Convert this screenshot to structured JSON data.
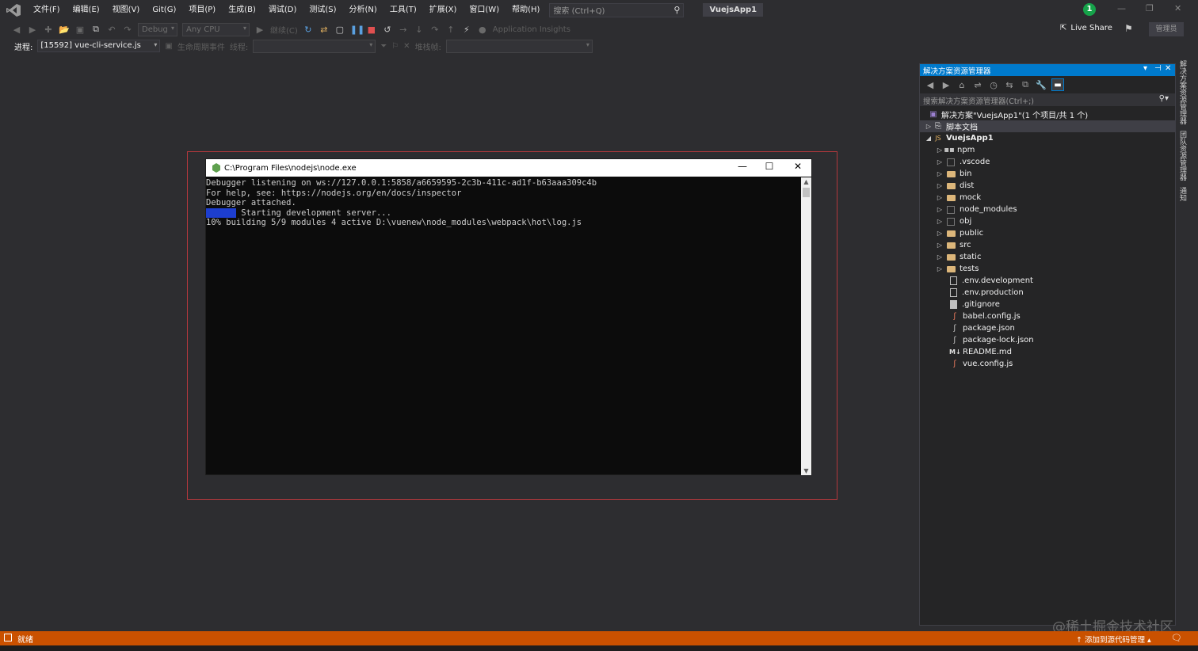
{
  "menubar": {
    "items": [
      "文件(F)",
      "编辑(E)",
      "视图(V)",
      "Git(G)",
      "项目(P)",
      "生成(B)",
      "调试(D)",
      "测试(S)",
      "分析(N)",
      "工具(T)",
      "扩展(X)",
      "窗口(W)",
      "帮助(H)"
    ],
    "search_placeholder": "搜索 (Ctrl+Q)",
    "app_title": "VuejsApp1",
    "notification_count": "1"
  },
  "toolbar": {
    "config": "Debug",
    "platform": "Any CPU",
    "continue_label": "继续(C)",
    "app_insights": "Application Insights",
    "live_share": "Live Share",
    "admin": "管理员"
  },
  "debug_toolbar": {
    "process_label": "进程:",
    "process_value": "[15592] vue-cli-service.js",
    "lifecycle_label": "生命周期事件",
    "thread_label": "线程:",
    "stackframe_label": "堆栈帧:"
  },
  "console": {
    "title": "C:\\Program Files\\nodejs\\node.exe",
    "lines": [
      "Debugger listening on ws://127.0.0.1:5858/a6659595-2c3b-411c-ad1f-b63aaa309c4b",
      "For help, see: https://nodejs.org/en/docs/inspector",
      "Debugger attached."
    ],
    "info_tag": " INFO ",
    "info_line": " Starting development server...",
    "progress_line": "10% building 5/9 modules 4 active D:\\vuenew\\node_modules\\webpack\\hot\\log.js"
  },
  "solution_explorer": {
    "title": "解决方案资源管理器",
    "search_placeholder": "搜索解决方案资源管理器(Ctrl+;)",
    "solution_label": "解决方案\"VuejsApp1\"(1 个项目/共 1 个)",
    "script_docs": "脚本文档",
    "project": "VuejsApp1",
    "folders": [
      "npm",
      ".vscode",
      "bin",
      "dist",
      "mock",
      "node_modules",
      "obj",
      "public",
      "src",
      "static",
      "tests"
    ],
    "files": [
      ".env.development",
      ".env.production",
      ".gitignore",
      "babel.config.js",
      "package.json",
      "package-lock.json",
      "README.md",
      "vue.config.js"
    ]
  },
  "side_tabs": [
    "解决方案资源管理器",
    "团队资源管理器",
    "通知"
  ],
  "statusbar": {
    "status": "就绪",
    "source_control": "添加到源代码管理"
  },
  "watermark": "@稀土掘金技术社区",
  "colors": {
    "accent": "#007acc",
    "statusbar": "#ca5100",
    "debug_frame": "#b3383d",
    "info_tag": "#1d3ecf",
    "badge": "#16a34a"
  }
}
